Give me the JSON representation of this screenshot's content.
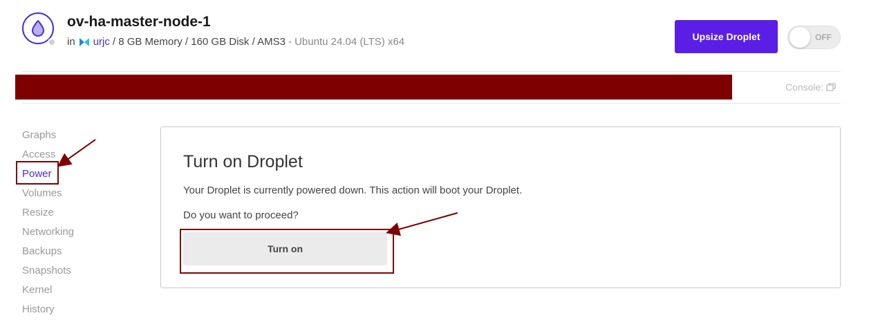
{
  "header": {
    "title": "ov-ha-master-node-1",
    "in_label": "in",
    "project": "urjc",
    "specs": "/ 8 GB Memory / 160 GB Disk / AMS3",
    "os": "- Ubuntu 24.04 (LTS) x64",
    "upsize_label": "Upsize Droplet",
    "power_toggle_label": "OFF",
    "power_toggle_state": "off"
  },
  "console": {
    "label": "Console:"
  },
  "sidebar": {
    "items": [
      {
        "label": "Graphs"
      },
      {
        "label": "Access"
      },
      {
        "label": "Power",
        "active": true
      },
      {
        "label": "Volumes"
      },
      {
        "label": "Resize"
      },
      {
        "label": "Networking"
      },
      {
        "label": "Backups"
      },
      {
        "label": "Snapshots"
      },
      {
        "label": "Kernel"
      },
      {
        "label": "History"
      }
    ]
  },
  "panel": {
    "title": "Turn on Droplet",
    "description": "Your Droplet is currently powered down. This action will boot your Droplet.",
    "question": "Do you want to proceed?",
    "button_label": "Turn on"
  },
  "colors": {
    "accent": "#5b1ee6",
    "link": "#4a2bd9",
    "annotation": "#7f0000",
    "redaction": "#7f0000"
  }
}
